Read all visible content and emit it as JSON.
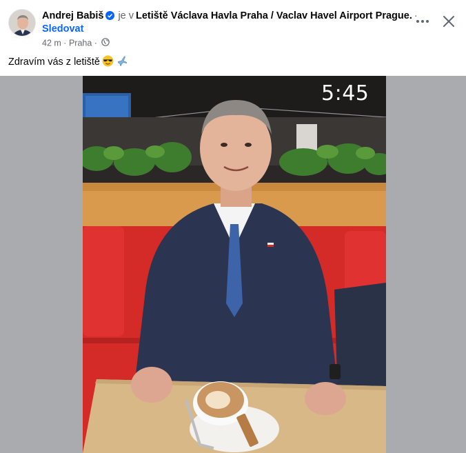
{
  "post": {
    "author": "Andrej Babiš",
    "checkin_prefix": "je v",
    "location": "Letiště Václava Havla Praha / Vaclav Havel Airport Prague.",
    "separator": "·",
    "follow_label": "Sledovat",
    "time": "42 m",
    "place": "Praha",
    "text": "Zdravím vás z letiště",
    "emojis": [
      "smiling-face-with-sunglasses",
      "airplane"
    ]
  },
  "media": {
    "timer_text": "5:45"
  },
  "colors": {
    "link": "#0866ff",
    "secondary_text": "#65676b",
    "media_background": "#a9abae",
    "sofa_red": "#d42a28"
  },
  "icons": [
    "verified-badge-icon",
    "globe-icon",
    "more-options-icon",
    "close-icon"
  ]
}
